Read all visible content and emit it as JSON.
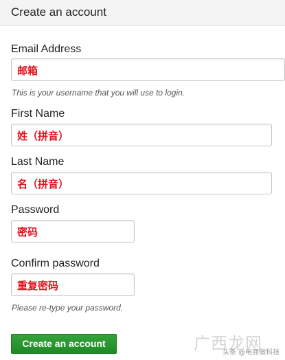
{
  "header": {
    "title": "Create an account"
  },
  "form": {
    "email": {
      "label": "Email Address",
      "value": "邮箱",
      "hint": "This is your username that you will use to login."
    },
    "first_name": {
      "label": "First Name",
      "value": "姓（拼音）"
    },
    "last_name": {
      "label": "Last Name",
      "value": "名（拼音）"
    },
    "password": {
      "label": "Password",
      "value": "密码"
    },
    "confirm_password": {
      "label": "Confirm password",
      "value": "重复密码",
      "hint": "Please re-type your password."
    },
    "submit_label": "Create an account"
  },
  "watermark": {
    "logo": "广西龙网",
    "line": "头条 @电商微科技"
  },
  "colors": {
    "submit": "#2a9a31",
    "value_text": "#e0141e",
    "header_bg": "#f4f4f4"
  }
}
